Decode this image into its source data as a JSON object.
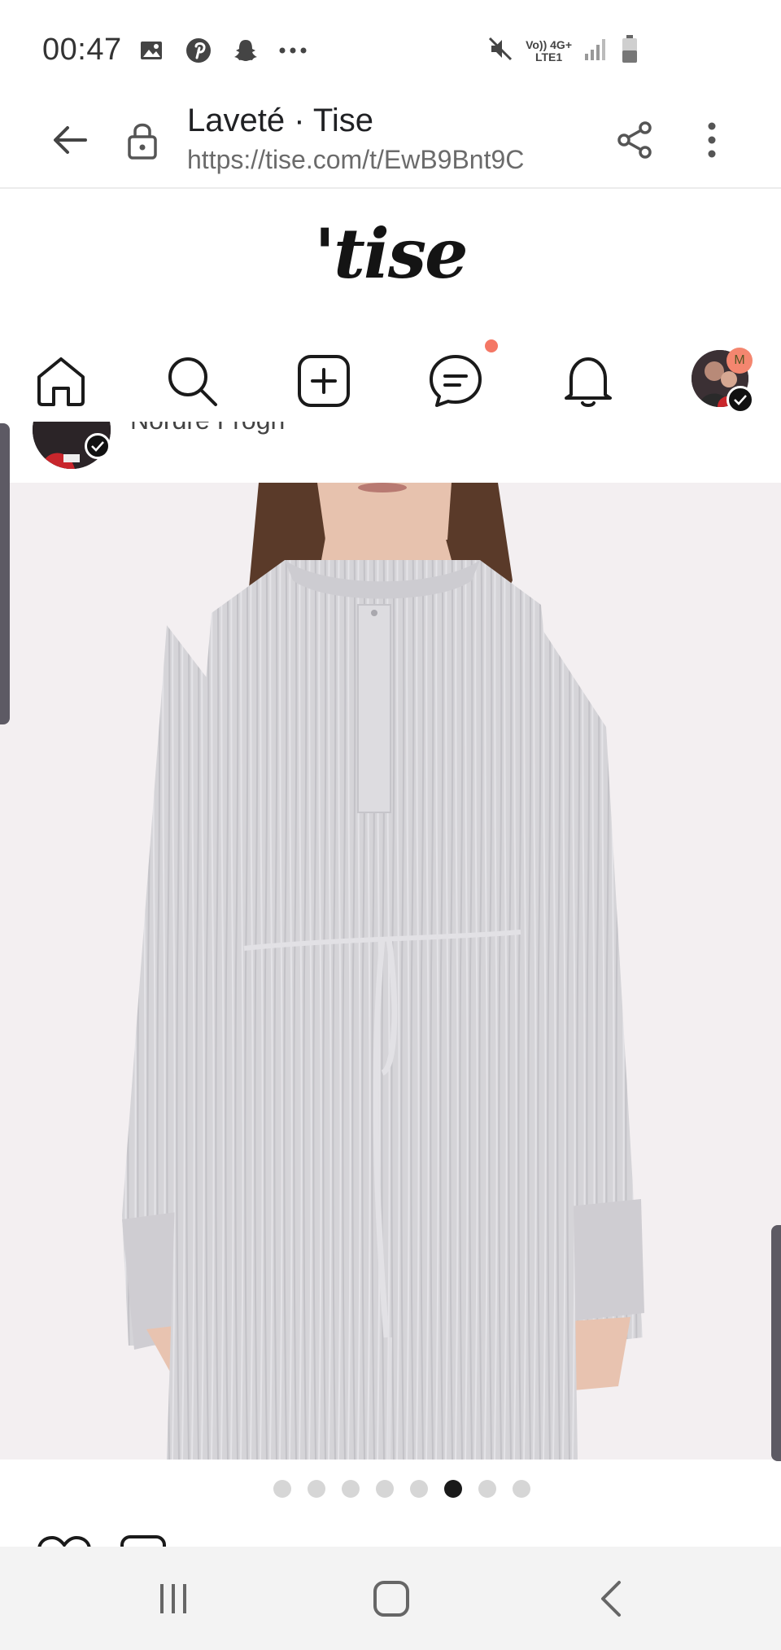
{
  "status_bar": {
    "time": "00:47",
    "notification_icons": [
      "gallery-icon",
      "pinterest-icon",
      "snapchat-icon",
      "more-dots-icon"
    ],
    "network_top": "Vo)) 4G+",
    "network_bottom": "LTE1"
  },
  "browser": {
    "title": "Laveté · Tise",
    "url": "https://tise.com/t/EwB9Bnt9C"
  },
  "site": {
    "logo": "'tise",
    "nav_items": [
      "home-icon",
      "search-icon",
      "add-post-icon",
      "messages-icon",
      "notifications-icon",
      "profile-avatar"
    ],
    "avatar_badge": "M",
    "accent_color": "#f47765"
  },
  "seller": {
    "name": "Nordre Frogn"
  },
  "carousel": {
    "total": 8,
    "active_index": 6
  },
  "colors": {
    "image_bg": "#f3eff1",
    "dot_active": "#1a1a1a",
    "dot_inactive": "#d6d6d6"
  }
}
